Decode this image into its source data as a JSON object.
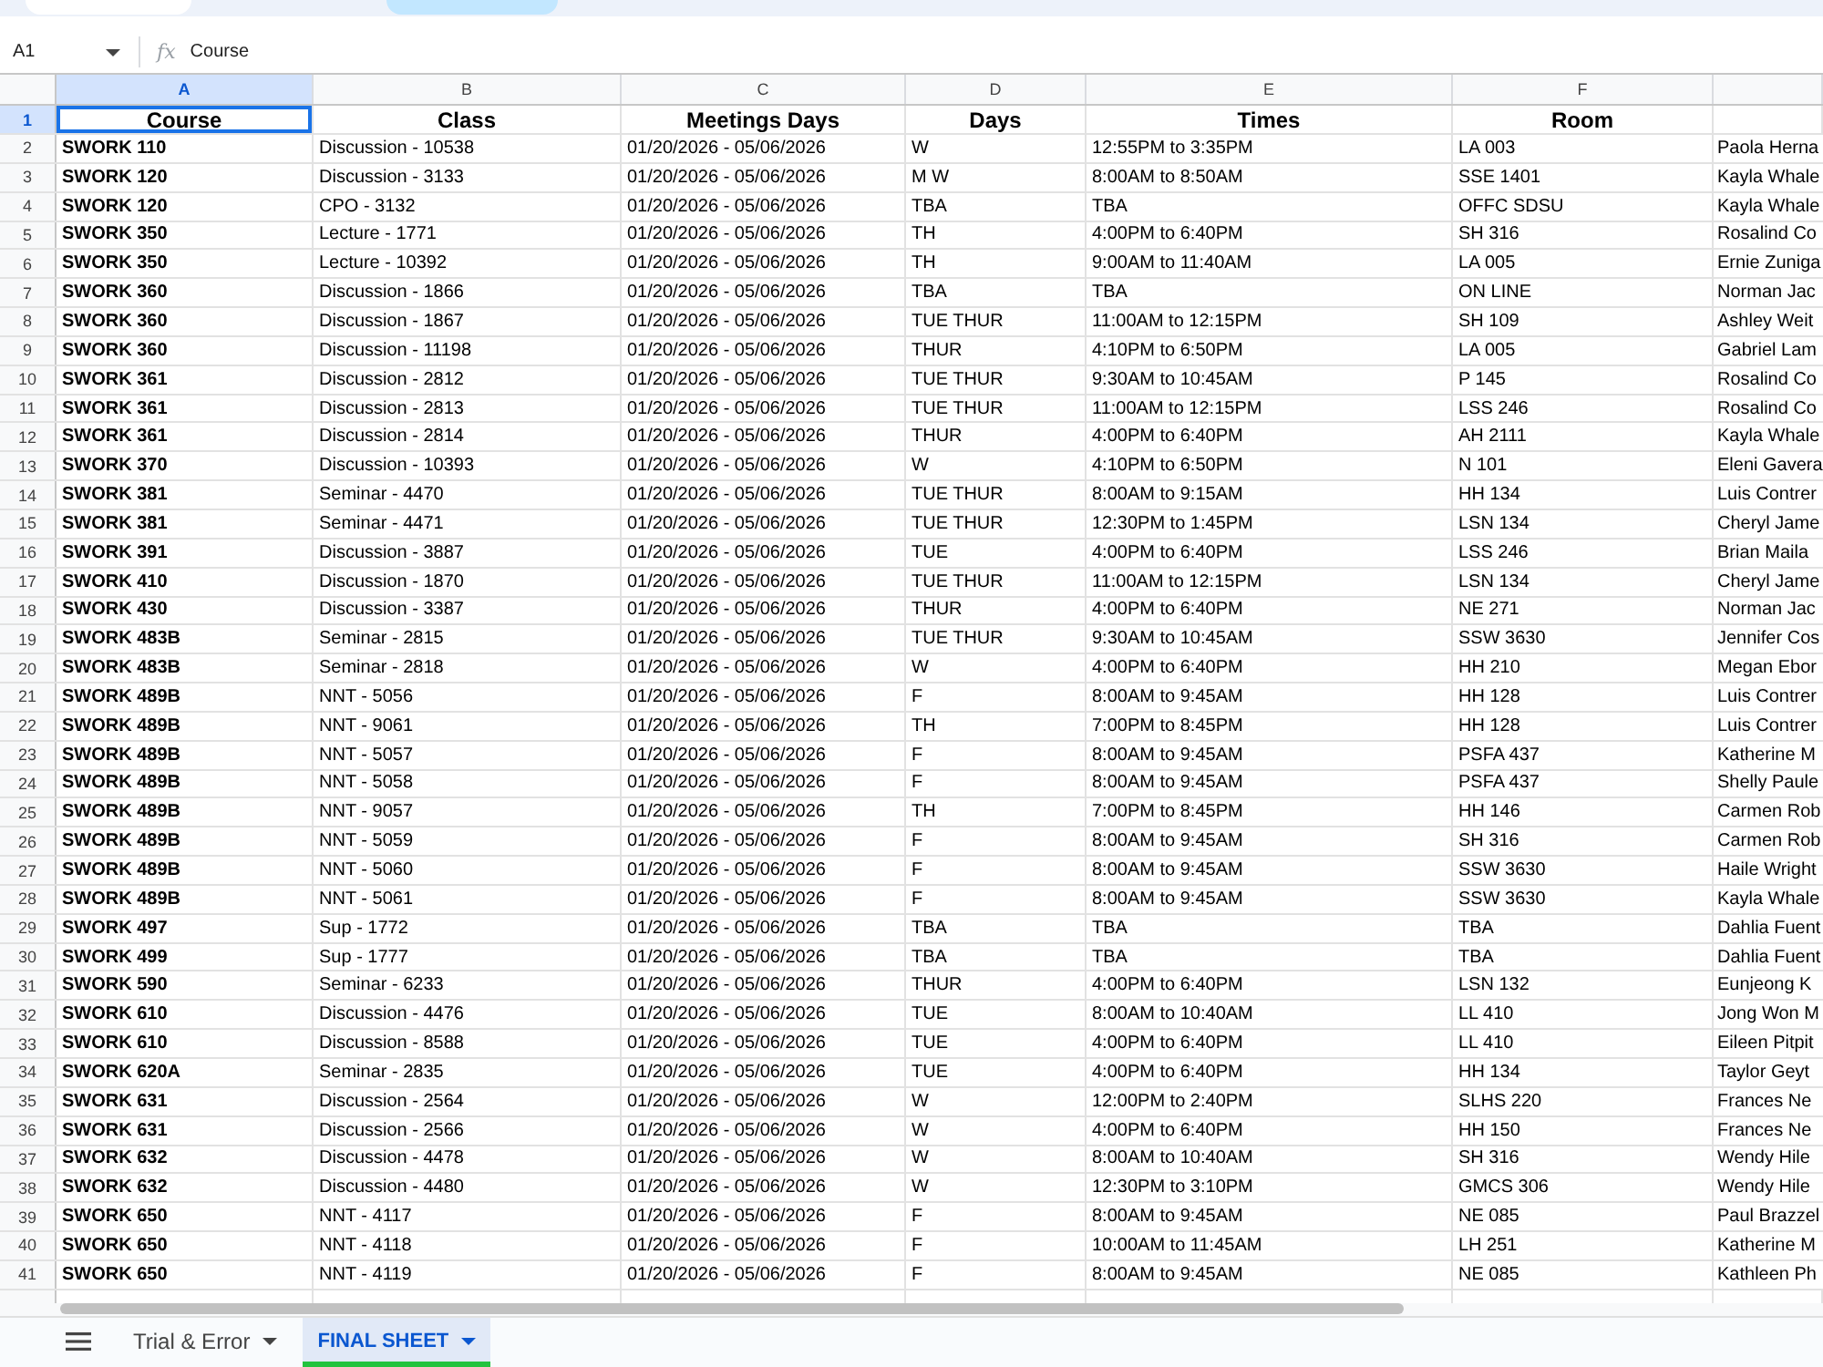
{
  "formula_bar": {
    "cell_ref": "A1",
    "formula_icon": "fx",
    "content": "Course"
  },
  "columns": [
    {
      "letter": "A",
      "selected": true
    },
    {
      "letter": "B",
      "selected": false
    },
    {
      "letter": "C",
      "selected": false
    },
    {
      "letter": "D",
      "selected": false
    },
    {
      "letter": "E",
      "selected": false
    },
    {
      "letter": "F",
      "selected": false
    }
  ],
  "rows": [
    {
      "number": "1",
      "kind": "heading",
      "selected": true,
      "cells": [
        "Course",
        "Class",
        "Meetings Days",
        "Days",
        "Times",
        "Room"
      ]
    },
    {
      "number": "2",
      "kind": "data",
      "selected": false,
      "cells": [
        "SWORK 110",
        "Discussion - 10538",
        "01/20/2026 - 05/06/2026",
        "W",
        "12:55PM to 3:35PM",
        "LA 003",
        "Paola Herna"
      ]
    },
    {
      "number": "3",
      "kind": "data",
      "selected": false,
      "cells": [
        "SWORK 120",
        "Discussion - 3133",
        "01/20/2026 - 05/06/2026",
        "M W",
        "8:00AM to 8:50AM",
        "SSE 1401",
        "Kayla Whale"
      ]
    },
    {
      "number": "4",
      "kind": "data",
      "selected": false,
      "cells": [
        "SWORK 120",
        "CPO - 3132",
        "01/20/2026 - 05/06/2026",
        "TBA",
        "TBA",
        "OFFC SDSU",
        "Kayla Whale"
      ]
    },
    {
      "number": "5",
      "kind": "data",
      "selected": false,
      "cells": [
        "SWORK 350",
        "Lecture - 1771",
        "01/20/2026 - 05/06/2026",
        "TH",
        "4:00PM to 6:40PM",
        "SH 316",
        "Rosalind Co"
      ]
    },
    {
      "number": "6",
      "kind": "data",
      "selected": false,
      "cells": [
        "SWORK 350",
        "Lecture - 10392",
        "01/20/2026 - 05/06/2026",
        "TH",
        "9:00AM to 11:40AM",
        "LA 005",
        "Ernie Zuniga"
      ]
    },
    {
      "number": "7",
      "kind": "data",
      "selected": false,
      "cells": [
        "SWORK 360",
        "Discussion - 1866",
        "01/20/2026 - 05/06/2026",
        "TBA",
        "TBA",
        "ON LINE",
        "Norman Jac"
      ]
    },
    {
      "number": "8",
      "kind": "data",
      "selected": false,
      "cells": [
        "SWORK 360",
        "Discussion - 1867",
        "01/20/2026 - 05/06/2026",
        "TUE THUR",
        "11:00AM to 12:15PM",
        "SH 109",
        "Ashley Weit"
      ]
    },
    {
      "number": "9",
      "kind": "data",
      "selected": false,
      "cells": [
        "SWORK 360",
        "Discussion - 11198",
        "01/20/2026 - 05/06/2026",
        "THUR",
        "4:10PM to 6:50PM",
        "LA 005",
        "Gabriel Lam"
      ]
    },
    {
      "number": "10",
      "kind": "data",
      "selected": false,
      "cells": [
        "SWORK 361",
        "Discussion - 2812",
        "01/20/2026 - 05/06/2026",
        "TUE THUR",
        "9:30AM to 10:45AM",
        "P 145",
        "Rosalind Co"
      ]
    },
    {
      "number": "11",
      "kind": "data",
      "selected": false,
      "cells": [
        "SWORK 361",
        "Discussion - 2813",
        "01/20/2026 - 05/06/2026",
        "TUE THUR",
        "11:00AM to 12:15PM",
        "LSS 246",
        "Rosalind Co"
      ]
    },
    {
      "number": "12",
      "kind": "data",
      "selected": false,
      "cells": [
        "SWORK 361",
        "Discussion - 2814",
        "01/20/2026 - 05/06/2026",
        "THUR",
        "4:00PM to 6:40PM",
        "AH 2111",
        "Kayla Whale"
      ]
    },
    {
      "number": "13",
      "kind": "data",
      "selected": false,
      "cells": [
        "SWORK 370",
        "Discussion - 10393",
        "01/20/2026 - 05/06/2026",
        "W",
        "4:10PM to 6:50PM",
        "N 101",
        "Eleni Gavera"
      ]
    },
    {
      "number": "14",
      "kind": "data",
      "selected": false,
      "cells": [
        "SWORK 381",
        "Seminar - 4470",
        "01/20/2026 - 05/06/2026",
        "TUE THUR",
        "8:00AM to 9:15AM",
        "HH 134",
        "Luis Contrer"
      ]
    },
    {
      "number": "15",
      "kind": "data",
      "selected": false,
      "cells": [
        "SWORK 381",
        "Seminar - 4471",
        "01/20/2026 - 05/06/2026",
        "TUE THUR",
        "12:30PM to 1:45PM",
        "LSN 134",
        "Cheryl Jame"
      ]
    },
    {
      "number": "16",
      "kind": "data",
      "selected": false,
      "cells": [
        "SWORK 391",
        "Discussion - 3887",
        "01/20/2026 - 05/06/2026",
        "TUE",
        "4:00PM to 6:40PM",
        "LSS 246",
        "Brian Maila"
      ]
    },
    {
      "number": "17",
      "kind": "data",
      "selected": false,
      "cells": [
        "SWORK 410",
        "Discussion - 1870",
        "01/20/2026 - 05/06/2026",
        "TUE THUR",
        "11:00AM to 12:15PM",
        "LSN 134",
        "Cheryl Jame"
      ]
    },
    {
      "number": "18",
      "kind": "data",
      "selected": false,
      "cells": [
        "SWORK 430",
        "Discussion - 3387",
        "01/20/2026 - 05/06/2026",
        "THUR",
        "4:00PM to 6:40PM",
        "NE 271",
        "Norman Jac"
      ]
    },
    {
      "number": "19",
      "kind": "data",
      "selected": false,
      "cells": [
        "SWORK 483B",
        "Seminar - 2815",
        "01/20/2026 - 05/06/2026",
        "TUE THUR",
        "9:30AM to 10:45AM",
        "SSW 3630",
        "Jennifer Cos"
      ]
    },
    {
      "number": "20",
      "kind": "data",
      "selected": false,
      "cells": [
        "SWORK 483B",
        "Seminar - 2818",
        "01/20/2026 - 05/06/2026",
        "W",
        "4:00PM to 6:40PM",
        "HH 210",
        "Megan Ebor"
      ]
    },
    {
      "number": "21",
      "kind": "data",
      "selected": false,
      "cells": [
        "SWORK 489B",
        "NNT - 5056",
        "01/20/2026 - 05/06/2026",
        "F",
        "8:00AM to 9:45AM",
        "HH 128",
        "Luis Contrer"
      ]
    },
    {
      "number": "22",
      "kind": "data",
      "selected": false,
      "cells": [
        "SWORK 489B",
        "NNT - 9061",
        "01/20/2026 - 05/06/2026",
        "TH",
        "7:00PM to 8:45PM",
        "HH 128",
        "Luis Contrer"
      ]
    },
    {
      "number": "23",
      "kind": "data",
      "selected": false,
      "cells": [
        "SWORK 489B",
        "NNT - 5057",
        "01/20/2026 - 05/06/2026",
        "F",
        "8:00AM to 9:45AM",
        "PSFA 437",
        "Katherine M"
      ]
    },
    {
      "number": "24",
      "kind": "data",
      "selected": false,
      "cells": [
        "SWORK 489B",
        "NNT - 5058",
        "01/20/2026 - 05/06/2026",
        "F",
        "8:00AM to 9:45AM",
        "PSFA 437",
        "Shelly Paule"
      ]
    },
    {
      "number": "25",
      "kind": "data",
      "selected": false,
      "cells": [
        "SWORK 489B",
        "NNT - 9057",
        "01/20/2026 - 05/06/2026",
        "TH",
        "7:00PM to 8:45PM",
        "HH 146",
        "Carmen Rob"
      ]
    },
    {
      "number": "26",
      "kind": "data",
      "selected": false,
      "cells": [
        "SWORK 489B",
        "NNT - 5059",
        "01/20/2026 - 05/06/2026",
        "F",
        "8:00AM to 9:45AM",
        "SH 316",
        "Carmen Rob"
      ]
    },
    {
      "number": "27",
      "kind": "data",
      "selected": false,
      "cells": [
        "SWORK 489B",
        "NNT - 5060",
        "01/20/2026 - 05/06/2026",
        "F",
        "8:00AM to 9:45AM",
        "SSW 3630",
        "Haile Wright"
      ]
    },
    {
      "number": "28",
      "kind": "data",
      "selected": false,
      "cells": [
        "SWORK 489B",
        "NNT - 5061",
        "01/20/2026 - 05/06/2026",
        "F",
        "8:00AM to 9:45AM",
        "SSW 3630",
        "Kayla Whale"
      ]
    },
    {
      "number": "29",
      "kind": "data",
      "selected": false,
      "cells": [
        "SWORK 497",
        "Sup - 1772",
        "01/20/2026 - 05/06/2026",
        "TBA",
        "TBA",
        "TBA",
        "Dahlia Fuent"
      ]
    },
    {
      "number": "30",
      "kind": "data",
      "selected": false,
      "cells": [
        "SWORK 499",
        "Sup - 1777",
        "01/20/2026 - 05/06/2026",
        "TBA",
        "TBA",
        "TBA",
        "Dahlia Fuent"
      ]
    },
    {
      "number": "31",
      "kind": "data",
      "selected": false,
      "cells": [
        "SWORK 590",
        "Seminar - 6233",
        "01/20/2026 - 05/06/2026",
        "THUR",
        "4:00PM to 6:40PM",
        "LSN 132",
        "Eunjeong K"
      ]
    },
    {
      "number": "32",
      "kind": "data",
      "selected": false,
      "cells": [
        "SWORK 610",
        "Discussion - 4476",
        "01/20/2026 - 05/06/2026",
        "TUE",
        "8:00AM to 10:40AM",
        "LL 410",
        "Jong Won M"
      ]
    },
    {
      "number": "33",
      "kind": "data",
      "selected": false,
      "cells": [
        "SWORK 610",
        "Discussion - 8588",
        "01/20/2026 - 05/06/2026",
        "TUE",
        "4:00PM to 6:40PM",
        "LL 410",
        "Eileen Pitpit"
      ]
    },
    {
      "number": "34",
      "kind": "data",
      "selected": false,
      "cells": [
        "SWORK 620A",
        "Seminar - 2835",
        "01/20/2026 - 05/06/2026",
        "TUE",
        "4:00PM to 6:40PM",
        "HH 134",
        "Taylor Geyt"
      ]
    },
    {
      "number": "35",
      "kind": "data",
      "selected": false,
      "cells": [
        "SWORK 631",
        "Discussion - 2564",
        "01/20/2026 - 05/06/2026",
        "W",
        "12:00PM to 2:40PM",
        "SLHS 220",
        "Frances Ne"
      ]
    },
    {
      "number": "36",
      "kind": "data",
      "selected": false,
      "cells": [
        "SWORK 631",
        "Discussion - 2566",
        "01/20/2026 - 05/06/2026",
        "W",
        "4:00PM to 6:40PM",
        "HH 150",
        "Frances Ne"
      ]
    },
    {
      "number": "37",
      "kind": "data",
      "selected": false,
      "cells": [
        "SWORK 632",
        "Discussion - 4478",
        "01/20/2026 - 05/06/2026",
        "W",
        "8:00AM to 10:40AM",
        "SH 316",
        "Wendy Hile"
      ]
    },
    {
      "number": "38",
      "kind": "data",
      "selected": false,
      "cells": [
        "SWORK 632",
        "Discussion - 4480",
        "01/20/2026 - 05/06/2026",
        "W",
        "12:30PM to 3:10PM",
        "GMCS 306",
        "Wendy Hile"
      ]
    },
    {
      "number": "39",
      "kind": "data",
      "selected": false,
      "cells": [
        "SWORK 650",
        "NNT - 4117",
        "01/20/2026 - 05/06/2026",
        "F",
        "8:00AM to 9:45AM",
        "NE 085",
        "Paul Brazzel"
      ]
    },
    {
      "number": "40",
      "kind": "data",
      "selected": false,
      "cells": [
        "SWORK 650",
        "NNT - 4118",
        "01/20/2026 - 05/06/2026",
        "F",
        "10:00AM to 11:45AM",
        "LH 251",
        "Katherine M"
      ]
    },
    {
      "number": "41",
      "kind": "data",
      "selected": false,
      "cells": [
        "SWORK 650",
        "NNT - 4119",
        "01/20/2026 - 05/06/2026",
        "F",
        "8:00AM to 9:45AM",
        "NE 085",
        "Kathleen Ph"
      ]
    }
  ],
  "sheet_tabs": [
    {
      "label": "Trial & Error",
      "selected": false
    },
    {
      "label": "FINAL SHEET",
      "selected": true
    }
  ]
}
